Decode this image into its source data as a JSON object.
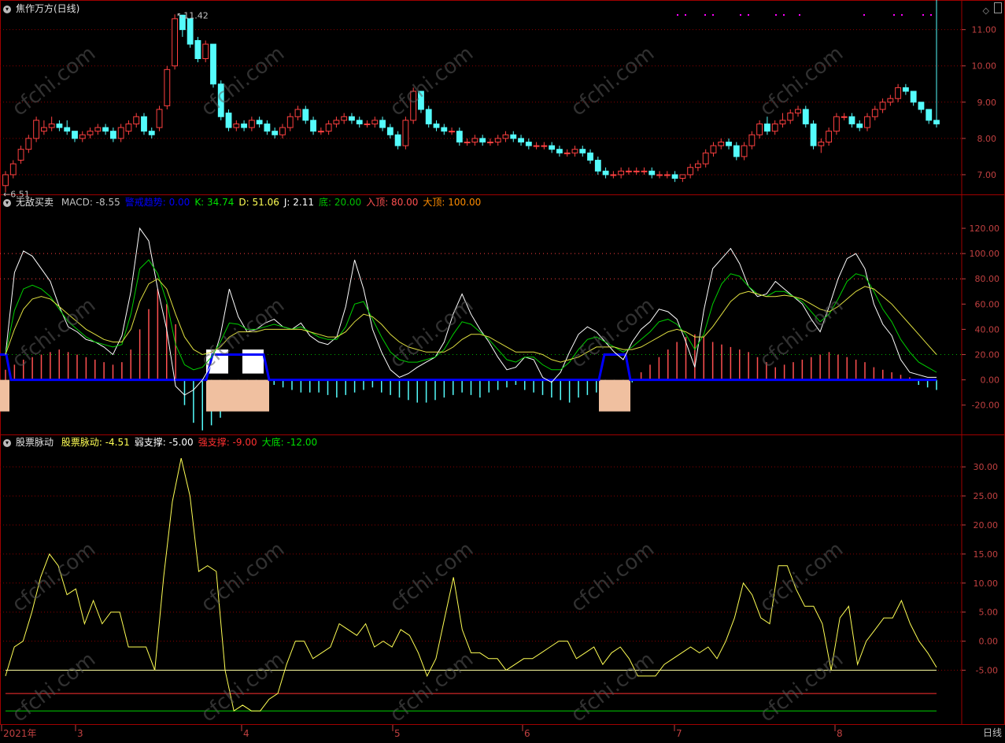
{
  "window": {
    "symbol_title": "焦作万方(日线)",
    "period_label": "日线"
  },
  "colors": {
    "up": "#ff4040",
    "down": "#54fcfc",
    "grid": "#8a0000",
    "axis_text": "#c04040",
    "white": "#ffffff",
    "yellow": "#ffff54",
    "green": "#00c000",
    "blue": "#0000ff",
    "peach": "#f0c0a0",
    "magenta": "#ff00ff"
  },
  "panels": {
    "price": {
      "title": "焦作万方(日线)",
      "high_label": "11.42",
      "low_label": "6.51",
      "y_ticks": [
        "11.00",
        "10.00",
        "9.00",
        "8.00",
        "7.00"
      ]
    },
    "macd": {
      "name": "无敌买卖",
      "legend": [
        {
          "text": "MACD: -8.55",
          "color": "#c0c0c0"
        },
        {
          "text": "警戒趋势: 0.00",
          "color": "#0000ff"
        },
        {
          "text": "K: 34.74",
          "color": "#00e000"
        },
        {
          "text": "D: 51.06",
          "color": "#ffff54"
        },
        {
          "text": "J: 2.11",
          "color": "#ffffff"
        },
        {
          "text": "底: 20.00",
          "color": "#00c000"
        },
        {
          "text": "入顶: 80.00",
          "color": "#ff5050"
        },
        {
          "text": "大顶: 100.00",
          "color": "#ff8c00"
        }
      ],
      "y_ticks": [
        "120.00",
        "100.00",
        "80.00",
        "60.00",
        "40.00",
        "20.00",
        "0.00",
        "-20.00"
      ]
    },
    "pulse": {
      "name": "股票脉动",
      "legend": [
        {
          "text": "股票脉动: -4.51",
          "color": "#ffff54"
        },
        {
          "text": "弱支撑: -5.00",
          "color": "#ffffff"
        },
        {
          "text": "强支撑: -9.00",
          "color": "#ff3030"
        },
        {
          "text": "大底: -12.00",
          "color": "#00e000"
        }
      ],
      "y_ticks": [
        "30.00",
        "25.00",
        "20.00",
        "15.00",
        "10.00",
        "5.00",
        "0.00",
        "-5.00"
      ]
    }
  },
  "x_axis": {
    "labels": [
      "2021年",
      "3",
      "4",
      "5",
      "6",
      "7",
      "8"
    ]
  },
  "watermark": "cfchi.com",
  "chart_data": [
    {
      "type": "candlestick",
      "title": "焦作万方(日线)",
      "ylim": [
        6.5,
        11.6
      ],
      "series": [
        {
          "name": "焦作万方",
          "open": [
            6.7,
            7.0,
            7.4,
            7.7,
            8.0,
            8.2,
            8.3,
            8.4,
            8.3,
            8.2,
            8.0,
            8.1,
            8.2,
            8.3,
            8.2,
            8.0,
            8.2,
            8.4,
            8.6,
            8.2,
            8.3,
            8.9,
            10.0,
            11.4,
            11.3,
            10.7,
            10.2,
            10.6,
            9.5,
            8.7,
            8.3,
            8.4,
            8.3,
            8.5,
            8.4,
            8.2,
            8.1,
            8.3,
            8.6,
            8.8,
            8.5,
            8.2,
            8.2,
            8.4,
            8.5,
            8.6,
            8.5,
            8.4,
            8.4,
            8.5,
            8.3,
            8.1,
            7.8,
            8.5,
            9.3,
            8.8,
            8.4,
            8.3,
            8.2,
            8.2,
            7.9,
            7.9,
            8.0,
            7.9,
            7.9,
            8.0,
            8.1,
            8.0,
            7.9,
            7.8,
            7.8,
            7.8,
            7.7,
            7.6,
            7.6,
            7.7,
            7.6,
            7.4,
            7.1,
            7.0,
            7.0,
            7.1,
            7.1,
            7.1,
            7.1,
            7.0,
            7.0,
            7.0,
            6.9,
            7.0,
            7.2,
            7.3,
            7.6,
            7.8,
            7.9,
            7.8,
            7.5,
            7.8,
            8.1,
            8.4,
            8.2,
            8.4,
            8.5,
            8.7,
            8.8,
            8.4,
            7.8,
            7.9,
            8.2,
            8.6,
            8.6,
            8.4,
            8.3,
            8.6,
            8.8,
            9.0,
            9.1,
            9.4,
            9.3,
            9.0,
            8.8,
            8.5
          ],
          "close": [
            7.0,
            7.3,
            7.7,
            8.0,
            8.5,
            8.3,
            8.4,
            8.3,
            8.2,
            8.0,
            8.1,
            8.2,
            8.3,
            8.2,
            8.0,
            8.3,
            8.4,
            8.6,
            8.2,
            8.1,
            8.8,
            9.9,
            11.3,
            11.0,
            10.6,
            10.2,
            10.6,
            9.5,
            8.6,
            8.3,
            8.4,
            8.3,
            8.5,
            8.4,
            8.2,
            8.1,
            8.3,
            8.6,
            8.8,
            8.5,
            8.2,
            8.2,
            8.4,
            8.5,
            8.6,
            8.5,
            8.4,
            8.4,
            8.5,
            8.3,
            8.1,
            7.8,
            8.5,
            9.3,
            8.8,
            8.4,
            8.3,
            8.2,
            8.2,
            7.9,
            7.9,
            8.0,
            7.9,
            7.9,
            8.0,
            8.1,
            8.0,
            7.9,
            7.8,
            7.8,
            7.8,
            7.7,
            7.6,
            7.6,
            7.7,
            7.6,
            7.4,
            7.1,
            7.0,
            7.0,
            7.1,
            7.1,
            7.1,
            7.1,
            7.0,
            7.0,
            7.0,
            6.9,
            7.0,
            7.2,
            7.3,
            7.6,
            7.8,
            7.9,
            7.8,
            7.5,
            7.8,
            8.1,
            8.4,
            8.2,
            8.4,
            8.5,
            8.7,
            8.8,
            8.4,
            7.8,
            7.9,
            8.2,
            8.6,
            8.6,
            8.4,
            8.3,
            8.6,
            8.8,
            9.0,
            9.1,
            9.4,
            9.3,
            9.0,
            8.8,
            8.5,
            8.4
          ],
          "high": [
            7.1,
            7.4,
            7.8,
            8.1,
            8.6,
            8.5,
            8.6,
            8.5,
            8.5,
            8.2,
            8.2,
            8.3,
            8.4,
            8.4,
            8.3,
            8.4,
            8.5,
            8.7,
            8.7,
            8.3,
            8.9,
            10.0,
            11.42,
            11.4,
            11.3,
            10.8,
            10.7,
            10.6,
            9.6,
            8.8,
            8.5,
            8.5,
            8.6,
            8.6,
            8.5,
            8.3,
            8.4,
            8.7,
            8.9,
            8.9,
            8.6,
            8.3,
            8.5,
            8.6,
            8.7,
            8.7,
            8.6,
            8.5,
            8.6,
            8.6,
            8.4,
            8.2,
            8.6,
            9.4,
            9.3,
            8.9,
            8.5,
            8.4,
            8.3,
            8.3,
            8.0,
            8.1,
            8.1,
            8.0,
            8.1,
            8.2,
            8.2,
            8.1,
            8.0,
            7.9,
            7.9,
            7.9,
            7.8,
            7.7,
            7.8,
            7.8,
            7.7,
            7.5,
            7.2,
            7.1,
            7.2,
            7.2,
            7.2,
            7.2,
            7.2,
            7.1,
            7.1,
            7.1,
            7.0,
            7.3,
            7.4,
            7.7,
            7.9,
            8.0,
            8.0,
            7.9,
            7.9,
            8.2,
            8.5,
            8.6,
            8.5,
            8.7,
            8.8,
            8.9,
            8.9,
            8.5,
            8.0,
            8.3,
            8.7,
            8.7,
            8.7,
            8.5,
            8.7,
            8.9,
            9.1,
            9.2,
            9.5,
            9.5,
            9.1,
            9.0,
            8.7
          ],
          "low": [
            6.51,
            6.9,
            7.3,
            7.6,
            7.9,
            8.1,
            8.2,
            8.2,
            8.1,
            7.9,
            7.9,
            8.0,
            8.1,
            8.1,
            7.9,
            7.9,
            8.1,
            8.3,
            8.1,
            8.0,
            8.2,
            8.8,
            9.9,
            10.8,
            10.5,
            10.1,
            10.1,
            9.4,
            8.5,
            8.2,
            8.2,
            8.2,
            8.2,
            8.3,
            8.1,
            8.0,
            8.0,
            8.2,
            8.5,
            8.4,
            8.1,
            8.1,
            8.1,
            8.3,
            8.4,
            8.4,
            8.3,
            8.3,
            8.3,
            8.2,
            8.0,
            7.7,
            7.7,
            8.4,
            8.7,
            8.3,
            8.2,
            8.1,
            8.1,
            7.8,
            7.8,
            7.8,
            7.8,
            7.8,
            7.8,
            7.9,
            7.9,
            7.8,
            7.7,
            7.7,
            7.7,
            7.6,
            7.5,
            7.5,
            7.5,
            7.5,
            7.3,
            7.0,
            6.9,
            6.9,
            6.9,
            7.0,
            7.0,
            7.0,
            6.9,
            6.9,
            6.9,
            6.8,
            6.8,
            6.9,
            7.1,
            7.2,
            7.5,
            7.7,
            7.7,
            7.4,
            7.4,
            7.7,
            8.0,
            8.1,
            8.1,
            8.3,
            8.4,
            8.6,
            8.3,
            7.7,
            7.6,
            7.8,
            8.1,
            8.5,
            8.3,
            8.2,
            8.2,
            8.5,
            8.7,
            8.9,
            9.0,
            9.2,
            8.9,
            8.7,
            8.4,
            8.3
          ]
        }
      ]
    },
    {
      "type": "line",
      "title": "无敌买卖",
      "ylim": [
        -42,
        135
      ],
      "reference_lines": [
        100,
        80,
        20,
        0
      ],
      "series": [
        {
          "name": "J",
          "values": [
            20,
            85,
            102,
            98,
            88,
            78,
            58,
            42,
            38,
            32,
            30,
            26,
            20,
            35,
            70,
            120,
            110,
            72,
            40,
            -5,
            -12,
            -8,
            0,
            12,
            35,
            72,
            50,
            38,
            40,
            45,
            48,
            42,
            40,
            45,
            35,
            30,
            28,
            34,
            58,
            95,
            72,
            40,
            22,
            8,
            2,
            5,
            10,
            14,
            18,
            30,
            52,
            68,
            52,
            40,
            30,
            18,
            8,
            10,
            18,
            16,
            2,
            -2,
            6,
            22,
            36,
            42,
            38,
            30,
            22,
            16,
            30,
            40,
            46,
            56,
            54,
            48,
            30,
            10,
            55,
            88,
            96,
            104,
            92,
            74,
            66,
            68,
            78,
            72,
            66,
            60,
            48,
            38,
            58,
            80,
            96,
            100,
            88,
            60,
            44,
            35,
            16,
            6,
            4,
            2,
            2
          ]
        },
        {
          "name": "K",
          "values": [
            20,
            55,
            72,
            75,
            72,
            66,
            56,
            46,
            40,
            34,
            30,
            28,
            26,
            28,
            52,
            88,
            95,
            84,
            62,
            28,
            12,
            8,
            10,
            18,
            30,
            45,
            44,
            40,
            40,
            42,
            44,
            42,
            40,
            42,
            38,
            34,
            32,
            32,
            42,
            60,
            62,
            48,
            34,
            22,
            16,
            14,
            14,
            16,
            18,
            24,
            36,
            46,
            44,
            38,
            32,
            24,
            16,
            14,
            18,
            18,
            12,
            8,
            8,
            14,
            24,
            32,
            34,
            30,
            26,
            22,
            26,
            32,
            38,
            46,
            48,
            44,
            36,
            24,
            36,
            60,
            76,
            84,
            82,
            74,
            68,
            66,
            70,
            70,
            66,
            62,
            54,
            46,
            52,
            64,
            78,
            84,
            82,
            70,
            56,
            46,
            32,
            22,
            14,
            10,
            6
          ]
        },
        {
          "name": "D",
          "values": [
            20,
            40,
            56,
            64,
            66,
            64,
            58,
            52,
            46,
            40,
            36,
            32,
            30,
            30,
            40,
            62,
            76,
            80,
            72,
            52,
            34,
            24,
            20,
            22,
            26,
            34,
            38,
            38,
            38,
            40,
            40,
            40,
            40,
            40,
            38,
            36,
            34,
            34,
            38,
            46,
            52,
            50,
            44,
            36,
            30,
            26,
            24,
            22,
            22,
            22,
            26,
            32,
            36,
            36,
            34,
            30,
            26,
            22,
            22,
            22,
            20,
            16,
            14,
            16,
            18,
            22,
            26,
            26,
            26,
            24,
            24,
            26,
            30,
            34,
            38,
            40,
            38,
            34,
            34,
            42,
            52,
            62,
            68,
            70,
            68,
            66,
            66,
            67,
            66,
            64,
            60,
            56,
            54,
            58,
            64,
            70,
            74,
            72,
            66,
            60,
            52,
            44,
            36,
            28,
            20
          ]
        }
      ],
      "macd_bars": [
        8,
        12,
        16,
        18,
        20,
        22,
        24,
        22,
        20,
        18,
        16,
        14,
        12,
        14,
        24,
        40,
        56,
        72,
        60,
        44,
        -20,
        -34,
        -40,
        -36,
        -30,
        -22,
        -14,
        -8,
        -4,
        -3,
        -4,
        -6,
        -8,
        -10,
        -10,
        -10,
        -12,
        -14,
        -12,
        -10,
        -8,
        -6,
        -10,
        -12,
        -14,
        -16,
        -18,
        -18,
        -16,
        -14,
        -12,
        -10,
        -12,
        -14,
        -10,
        -8,
        -6,
        -4,
        -8,
        -10,
        -12,
        -14,
        -16,
        -18,
        -14,
        -12,
        -10,
        -8,
        -6,
        -4,
        -2,
        6,
        12,
        18,
        24,
        30,
        34,
        36,
        34,
        30,
        28,
        26,
        24,
        22,
        18,
        14,
        10,
        12,
        14,
        16,
        18,
        20,
        22,
        20,
        18,
        16,
        14,
        10,
        8,
        6,
        4,
        2,
        -4,
        -6,
        -8
      ]
    },
    {
      "type": "line",
      "title": "股票脉动",
      "ylim": [
        -14,
        33
      ],
      "reference_lines": [
        {
          "name": "弱支撑",
          "value": -5
        },
        {
          "name": "强支撑",
          "value": -9
        },
        {
          "name": "大底",
          "value": -12
        }
      ],
      "series": [
        {
          "name": "股票脉动",
          "values": [
            -6,
            -1,
            0,
            5,
            11,
            15,
            13,
            8,
            9,
            3,
            7,
            3,
            5,
            5,
            -1,
            -1,
            -1,
            -5,
            11,
            24,
            31.5,
            25,
            12,
            13,
            12,
            -5,
            -12,
            -11,
            -12,
            -12,
            -10,
            -9,
            -4,
            0,
            0,
            -3,
            -2,
            -1,
            3,
            2,
            1,
            3,
            -1,
            0,
            -1,
            2,
            1,
            -2,
            -6,
            -3,
            4,
            11,
            2,
            -2,
            -2,
            -3,
            -3,
            -5,
            -4,
            -3,
            -3,
            -2,
            -1,
            0,
            0,
            -3,
            -2,
            -1,
            -4,
            -2,
            -1,
            -3,
            -6,
            -6,
            -6,
            -4,
            -3,
            -2,
            -1,
            -2,
            -1,
            -3,
            0,
            4,
            10,
            8,
            4,
            3,
            13,
            13,
            9,
            6,
            6,
            3,
            -5,
            4,
            6,
            -4,
            0,
            2,
            4,
            4,
            7,
            3,
            0,
            -2,
            -4.5
          ]
        }
      ]
    }
  ]
}
